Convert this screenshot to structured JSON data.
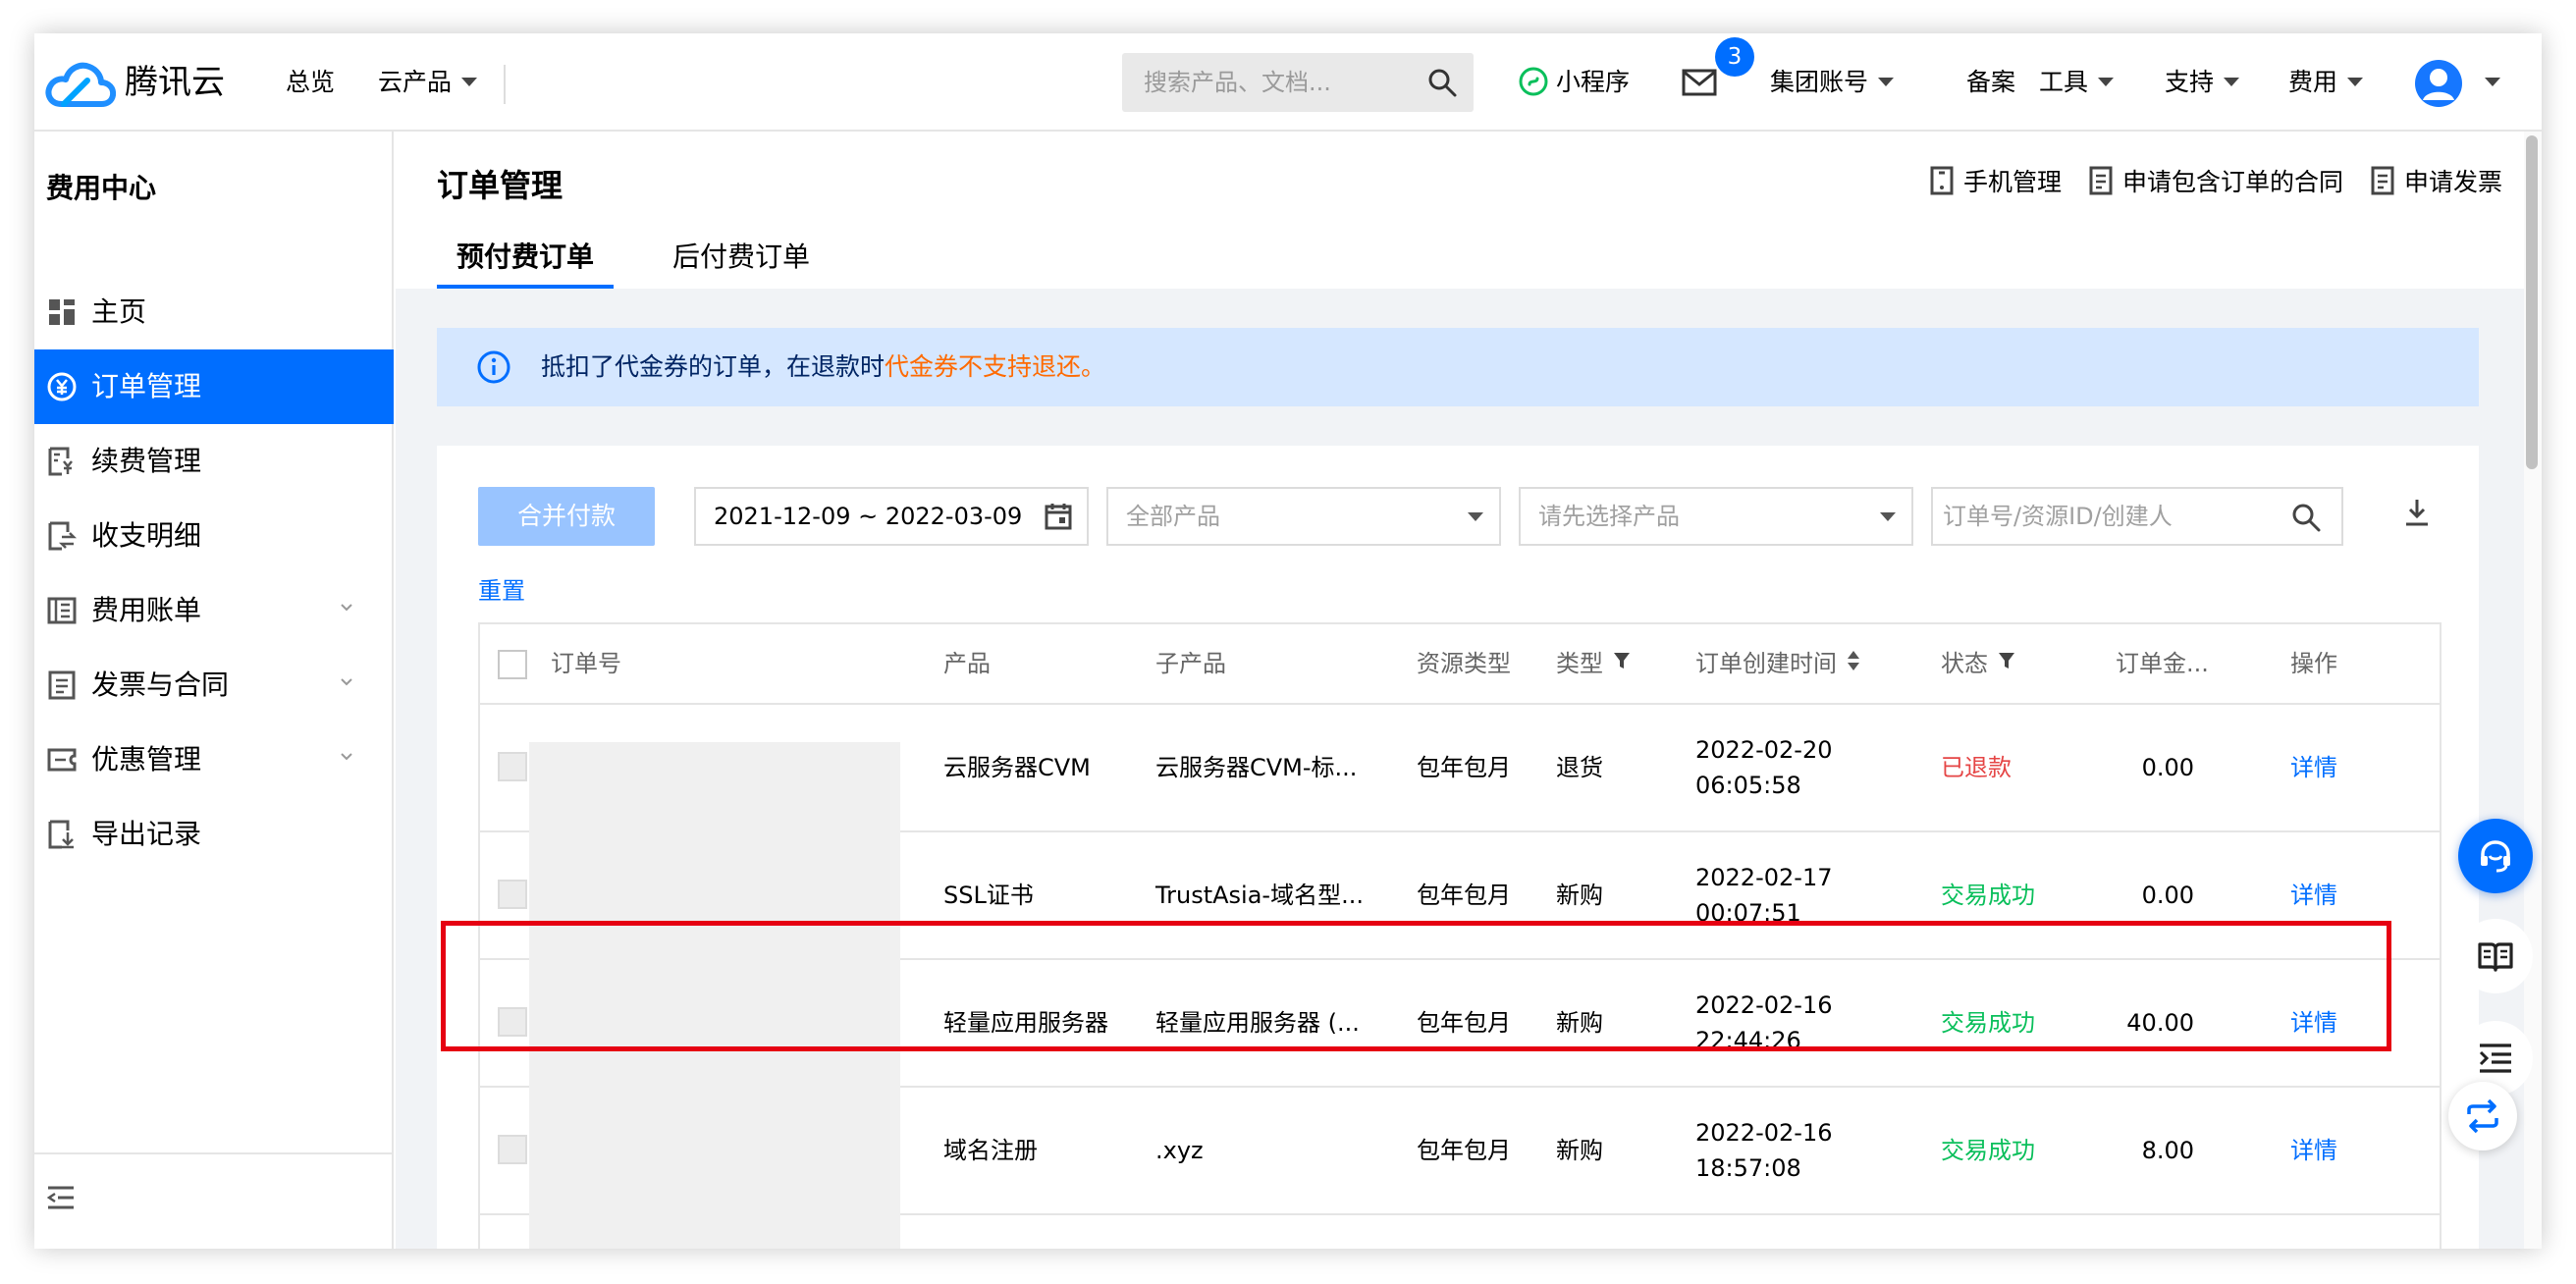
{
  "topnav": {
    "brand": "腾讯云",
    "overview": "总览",
    "products": "云产品",
    "search_placeholder": "搜索产品、文档...",
    "miniprogram": "小程序",
    "mail_badge": "3",
    "group_account": "集团账号",
    "filing": "备案",
    "tools": "工具",
    "support": "支持",
    "fees": "费用"
  },
  "sidebar": {
    "title": "费用中心",
    "items": [
      {
        "label": "主页"
      },
      {
        "label": "订单管理"
      },
      {
        "label": "续费管理"
      },
      {
        "label": "收支明细"
      },
      {
        "label": "费用账单"
      },
      {
        "label": "发票与合同"
      },
      {
        "label": "优惠管理"
      },
      {
        "label": "导出记录"
      }
    ]
  },
  "main": {
    "title": "订单管理",
    "links": {
      "phone": "手机管理",
      "contract": "申请包含订单的合同",
      "invoice": "申请发票"
    },
    "tabs": [
      "预付费订单",
      "后付费订单"
    ],
    "notice": {
      "text": "抵扣了代金券的订单，在退款时",
      "warn": "代金券不支持退还。"
    },
    "filters": {
      "merge_pay": "合并付款",
      "date_range": "2021-12-09 ~ 2022-03-09",
      "all_products": "全部产品",
      "select_product": "请先选择产品",
      "search_placeholder": "订单号/资源ID/创建人",
      "reset": "重置"
    },
    "table": {
      "headers": {
        "order_no": "订单号",
        "product": "产品",
        "sub_product": "子产品",
        "resource_type": "资源类型",
        "type": "类型",
        "created": "订单创建时间",
        "status": "状态",
        "amount": "订单金...",
        "action": "操作"
      },
      "rows": [
        {
          "product": "云服务器CVM",
          "sub": "云服务器CVM-标...",
          "rtype": "包年包月",
          "type": "退货",
          "date": "2022-02-20",
          "time": "06:05:58",
          "status": "已退款",
          "amount": "0.00",
          "action": "详情"
        },
        {
          "product": "SSL证书",
          "sub": "TrustAsia-域名型...",
          "rtype": "包年包月",
          "type": "新购",
          "date": "2022-02-17",
          "time": "00:07:51",
          "status": "交易成功",
          "amount": "0.00",
          "action": "详情"
        },
        {
          "product": "轻量应用服务器",
          "sub": "轻量应用服务器 (...",
          "rtype": "包年包月",
          "type": "新购",
          "date": "2022-02-16",
          "time": "22:44:26",
          "status": "交易成功",
          "amount": "40.00",
          "action": "详情"
        },
        {
          "product": "域名注册",
          "sub": ".xyz",
          "rtype": "包年包月",
          "type": "新购",
          "date": "2022-02-16",
          "time": "18:57:08",
          "status": "交易成功",
          "amount": "8.00",
          "action": "详情"
        }
      ]
    }
  },
  "colors": {
    "accent": "#006eff",
    "refunded": "#e54545",
    "success": "#0abf5b",
    "warning": "#ff6a00",
    "highlight_box": "#e60012"
  }
}
